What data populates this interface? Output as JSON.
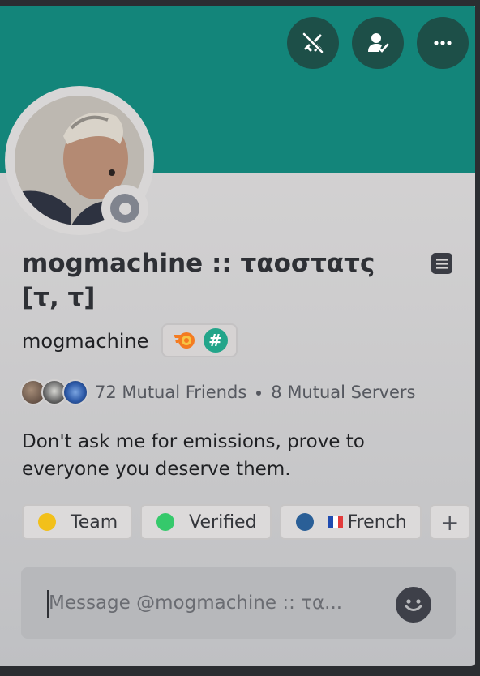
{
  "header": {
    "actions": [
      {
        "name": "no-swords-icon"
      },
      {
        "name": "user-check-icon"
      },
      {
        "name": "more-icon"
      }
    ]
  },
  "profile": {
    "display_name": "mogmachine :: ταοστατς [τ, τ]",
    "username": "mogmachine",
    "status": "offline",
    "badges": [
      {
        "name": "nitro-badge-icon"
      },
      {
        "name": "hash-badge-icon",
        "glyph": "#"
      }
    ]
  },
  "mutual": {
    "friends": "72 Mutual Friends",
    "servers": "8 Mutual Servers"
  },
  "bio": "Don't ask me for emissions, prove to everyone you deserve them.",
  "roles": [
    {
      "label": "Team",
      "color": "#f2c01a"
    },
    {
      "label": "Verified",
      "color": "#35c96b"
    },
    {
      "label": "French",
      "color": "#2a5f97",
      "flag": true
    }
  ],
  "roles_add_label": "+",
  "message": {
    "placeholder": "Message @mogmachine :: τα..."
  },
  "colors": {
    "banner": "#13857a",
    "action_bg": "#1d4f48"
  }
}
